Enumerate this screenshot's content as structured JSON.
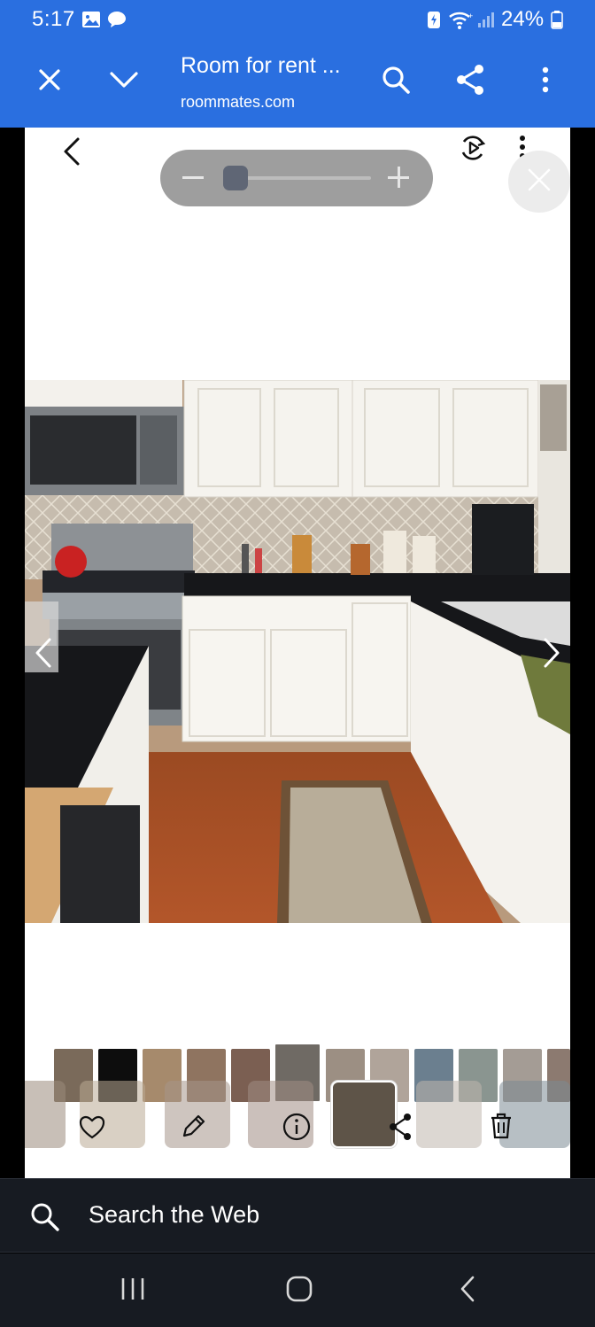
{
  "status_bar": {
    "time": "5:17",
    "battery": "24%",
    "icons": [
      "gallery-notification-icon",
      "chat-notification-icon",
      "battery-saver-icon",
      "wifi-icon",
      "signal-icon",
      "battery-icon"
    ]
  },
  "toolbar": {
    "title": "Room for rent ...",
    "url": "roommates.com",
    "icons": [
      "close-icon",
      "chevron-down-icon",
      "search-icon",
      "share-icon",
      "more-vert-icon"
    ]
  },
  "viewer": {
    "zoom_level": 0.1,
    "image_description_icons": [
      "back-icon",
      "motion-photo-icon",
      "more-vert-icon",
      "close-icon",
      "prev-arrow-icon",
      "next-arrow-icon"
    ],
    "thumbnail_count_back": 12,
    "thumbnail_count_front": 7,
    "selected_thumbnail_index": 4,
    "actions": [
      "heart-icon",
      "edit-icon",
      "info-icon",
      "share-icon",
      "trash-icon"
    ]
  },
  "search": {
    "label": "Search the Web"
  },
  "navigation": {
    "buttons": [
      "recents-icon",
      "home-icon",
      "back-icon"
    ]
  },
  "colors": {
    "toolbar": "#2a6fe0",
    "dark_bar": "#171b22"
  }
}
